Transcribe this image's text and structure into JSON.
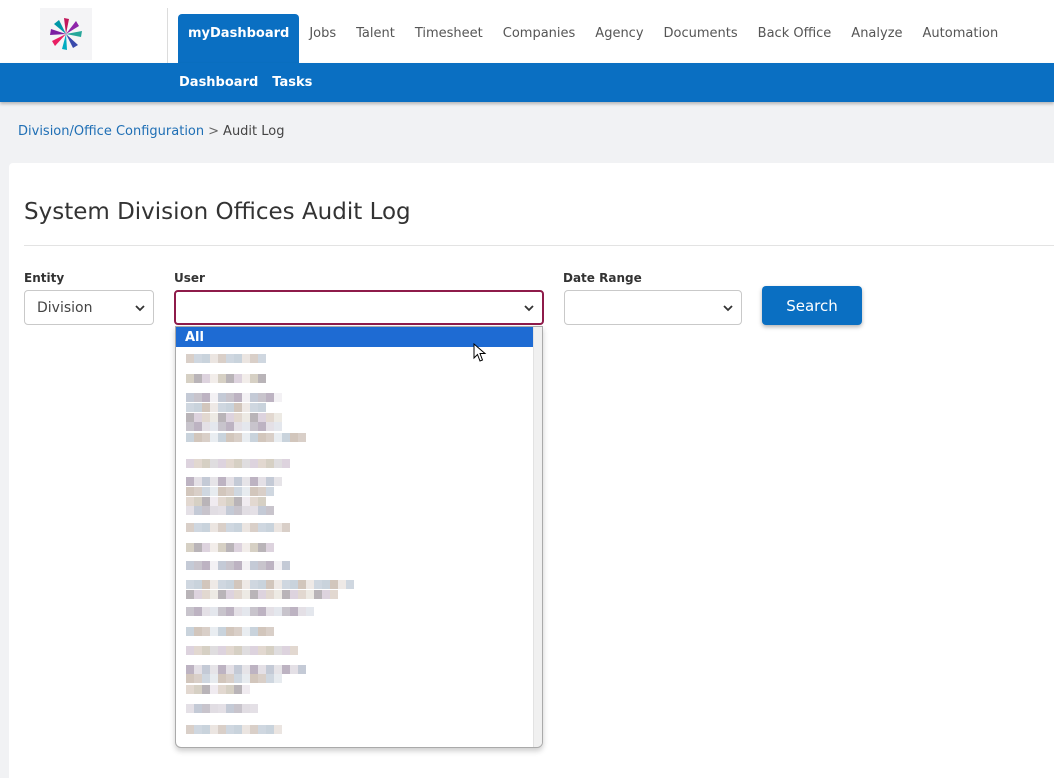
{
  "nav": {
    "items": [
      "myDashboard",
      "Jobs",
      "Talent",
      "Timesheet",
      "Companies",
      "Agency",
      "Documents",
      "Back Office",
      "Analyze",
      "Automation"
    ],
    "active_index": 0
  },
  "subnav": {
    "items": [
      "Dashboard",
      "Tasks"
    ]
  },
  "breadcrumb": {
    "parent": "Division/Office Configuration",
    "separator": ">",
    "current": "Audit Log"
  },
  "page": {
    "title": "System Division Offices Audit Log"
  },
  "filters": {
    "entity": {
      "label": "Entity",
      "value": "Division"
    },
    "user": {
      "label": "User",
      "value": ""
    },
    "date_range": {
      "label": "Date Range",
      "value": ""
    },
    "search_label": "Search"
  },
  "user_dropdown": {
    "selected_option": "All"
  },
  "colors": {
    "brand_blue": "#0a6fc2",
    "focus_border": "#8e1b4a",
    "option_highlight": "#1e6bd3"
  },
  "icons": {
    "logo": "star-burst-logo",
    "chevron": "chevron-down-icon",
    "pointer": "mouse-pointer-icon"
  }
}
